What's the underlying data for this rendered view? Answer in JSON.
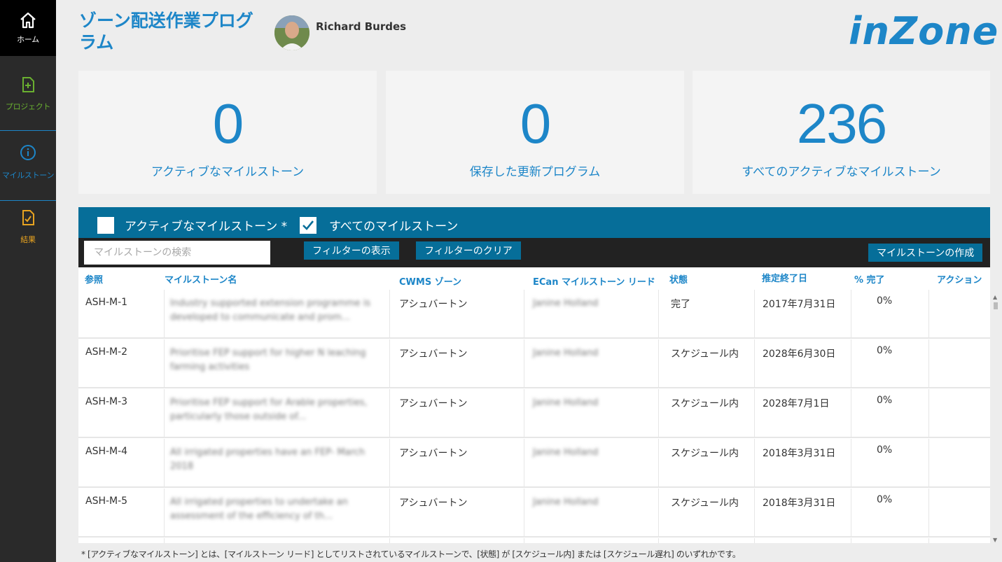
{
  "sidebar": {
    "items": [
      {
        "label": "ホーム",
        "icon": "home-icon",
        "color": "#ffffff"
      },
      {
        "label": "プロジェクト",
        "icon": "add-file-icon",
        "color": "#6ab030"
      },
      {
        "label": "マイルストーン",
        "icon": "info-icon",
        "color": "#1d86c8"
      },
      {
        "label": "結果",
        "icon": "checked-file-icon",
        "color": "#e8a320"
      }
    ]
  },
  "header": {
    "title": "ゾーン配送作業プログラム",
    "user_name": "Richard Burdes",
    "logo_text": "inZone"
  },
  "stats": [
    {
      "value": "0",
      "label": "アクティブなマイルストーン"
    },
    {
      "value": "0",
      "label": "保存した更新プログラム"
    },
    {
      "value": "236",
      "label": "すべてのアクティブなマイルストーン"
    }
  ],
  "filters": {
    "active_label": "アクティブなマイルストーン *",
    "active_checked": false,
    "all_label": "すべてのマイルストーン",
    "all_checked": true
  },
  "toolbar": {
    "search_placeholder": "マイルストーンの検索",
    "show_filters": "フィルターの表示",
    "clear_filters": "フィルターのクリア",
    "create_milestone": "マイルストーンの作成"
  },
  "table": {
    "columns": [
      "参照",
      "マイルストーン名",
      "CWMS ゾーン",
      "ECan マイルストーン リード",
      "状態",
      "推定終了日",
      "% 完了",
      "アクション"
    ],
    "rows": [
      {
        "ref": "ASH-M-1",
        "name": "Industry supported extension programme is developed to communicate and prom...",
        "zone": "アシュバートン",
        "lead": "Janine Holland",
        "status": "完了",
        "end_date": "2017年7月31日",
        "complete": "0%"
      },
      {
        "ref": "ASH-M-2",
        "name": "Prioritise FEP support for higher N leaching farming activities",
        "zone": "アシュバートン",
        "lead": "Janine Holland",
        "status": "スケジュール内",
        "end_date": "2028年6月30日",
        "complete": "0%"
      },
      {
        "ref": "ASH-M-3",
        "name": "Prioritise FEP support for Arable properties, particularly those outside of...",
        "zone": "アシュバートン",
        "lead": "Janine Holland",
        "status": "スケジュール内",
        "end_date": "2028年7月1日",
        "complete": "0%"
      },
      {
        "ref": "ASH-M-4",
        "name": "All irrigated properties have an FEP- March 2018",
        "zone": "アシュバートン",
        "lead": "Janine Holland",
        "status": "スケジュール内",
        "end_date": "2018年3月31日",
        "complete": "0%"
      },
      {
        "ref": "ASH-M-5",
        "name": "All irrigated properties to undertake an assessment of the efficiency of th...",
        "zone": "アシュバートン",
        "lead": "Janine Holland",
        "status": "スケジュール内",
        "end_date": "2018年3月31日",
        "complete": "0%"
      }
    ]
  },
  "footnote": "* [アクティブなマイルストーン] とは、[マイルストーン リード] としてリストされているマイルストーンで、[状態] が [スケジュール内] または [スケジュール遅れ] のいずれかです。"
}
